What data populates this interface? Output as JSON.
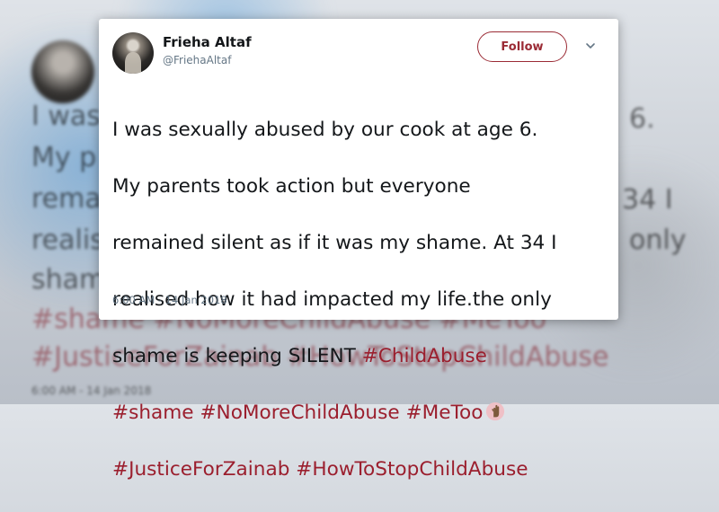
{
  "background": {
    "lines": [
      {
        "text": "I was",
        "hashtag": false
      },
      {
        "text": "My p",
        "hashtag": false
      },
      {
        "text": "rema",
        "hashtag": false
      },
      {
        "text": "realis",
        "hashtag": false
      },
      {
        "text": "sham",
        "hashtag": false
      }
    ],
    "right_fragments": [
      "6.",
      "34 I",
      "only"
    ],
    "bottom_lines": [
      {
        "text": "#shame #NoMoreChildAbuse #MeToo",
        "hashtag": true
      },
      {
        "text": "#JusticeForZainab #HowToStopChildAbuse",
        "hashtag": true
      },
      {
        "text": "6:00 AM - 14 Jan 2018",
        "hashtag": false
      }
    ]
  },
  "tweet": {
    "author": {
      "name": "Frieha Altaf",
      "handle": "@FriehaAltaf"
    },
    "follow_label": "Follow",
    "lines": [
      [
        "I was sexually abused by our cook at age 6."
      ],
      [
        "My parents took action but everyone"
      ],
      [
        "remained silent as if it was my shame. At 34 I"
      ],
      [
        "realised how it had impacted my life.the only"
      ]
    ],
    "line5_text": "shame is keeping SILENT ",
    "hashtags": {
      "child_abuse": "#ChildAbuse",
      "shame": "#shame",
      "no_more": "#NoMoreChildAbuse",
      "metoo": "#MeToo",
      "justice": "#JusticeForZainab",
      "how_to_stop": "#HowToStopChildAbuse"
    },
    "emoji_icon": "raised-hand-icon",
    "timestamp": "6:00 AM - 14 Jan 2018"
  },
  "colors": {
    "hashtag": "#9b1f2e",
    "follow_border": "#9b2b35",
    "handle": "#657786"
  }
}
